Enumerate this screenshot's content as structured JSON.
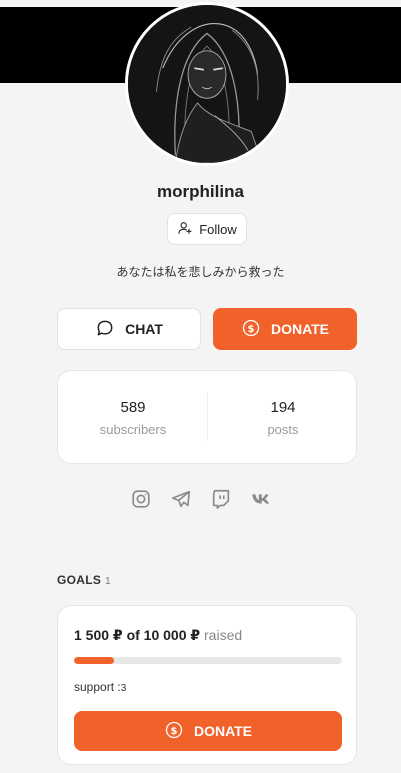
{
  "profile": {
    "username": "morphilina",
    "follow_label": "Follow",
    "bio": "あなたは私を悲しみから救った"
  },
  "actions": {
    "chat_label": "CHAT",
    "donate_label": "DONATE"
  },
  "stats": {
    "subscribers_value": "589",
    "subscribers_label": "subscribers",
    "posts_value": "194",
    "posts_label": "posts"
  },
  "socials": [
    "instagram-icon",
    "telegram-icon",
    "twitch-icon",
    "vk-icon"
  ],
  "goals": {
    "title": "GOALS",
    "count": "1",
    "items": [
      {
        "raised_amount": "1 500 ₽",
        "of_word": "of",
        "target_amount": "10 000 ₽",
        "raised_word": "raised",
        "progress_percent": 15,
        "support_label": "support :",
        "support_count": "3",
        "donate_label": "DONATE"
      }
    ]
  },
  "colors": {
    "accent": "#f1622b",
    "background": "#f4f4f4",
    "banner": "#000000"
  }
}
